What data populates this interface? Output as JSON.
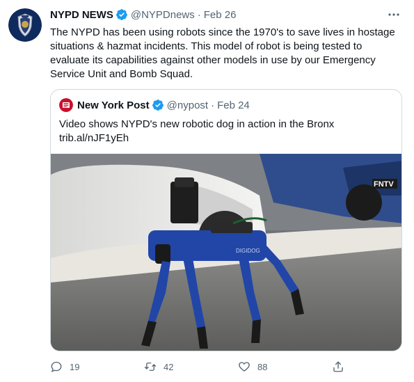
{
  "tweet": {
    "author_name": "NYPD NEWS",
    "author_handle": "@NYPDnews",
    "separator": "·",
    "date": "Feb 26",
    "text": "The NYPD has been using robots since the 1970's to save lives in hostage situations & hazmat incidents. This model of robot is being tested to evaluate its capabilities against other models in use by our Emergency Service Unit and Bomb Squad.",
    "avatar_icon": "nypd-badge-icon",
    "colors": {
      "verified": "#1d9bf0",
      "text": "#0f1419",
      "secondary": "#536471",
      "border": "#cfd9de"
    }
  },
  "quote": {
    "author_name": "New York Post",
    "author_handle": "@nypost",
    "separator": "·",
    "date": "Feb 24",
    "text": "Video shows NYPD's new robotic dog in action in the Bronx",
    "link": "trib.al/nJF1yEh",
    "media_watermark": "FNTV",
    "robot_label": "DIGIDOG",
    "logo_color": "#c8102e"
  },
  "actions": {
    "replies": "19",
    "retweets": "42",
    "likes": "88"
  }
}
